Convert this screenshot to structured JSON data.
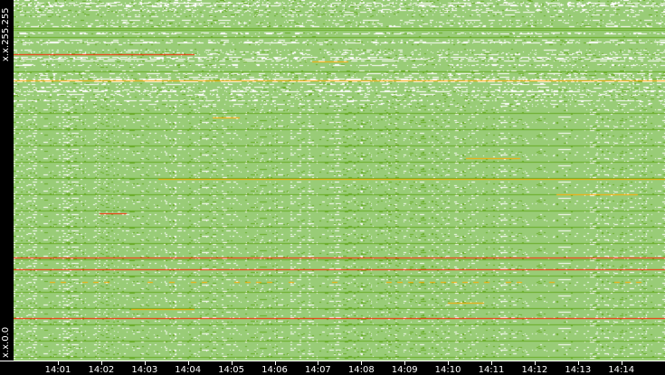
{
  "y_axis": {
    "top_label": "x.x.255.255",
    "bottom_label": "x.x.0.0"
  },
  "x_axis": {
    "ticks": [
      "14:01",
      "14:02",
      "14:03",
      "14:04",
      "14:05",
      "14:06",
      "14:07",
      "14:08",
      "14:09",
      "14:10",
      "14:11",
      "14:12",
      "14:13",
      "14:14"
    ]
  },
  "colors": {
    "background": "#000000",
    "low": "#99cc77",
    "mid": "#66aa22",
    "high": "#ffaa00",
    "max": "#ff2200"
  }
}
